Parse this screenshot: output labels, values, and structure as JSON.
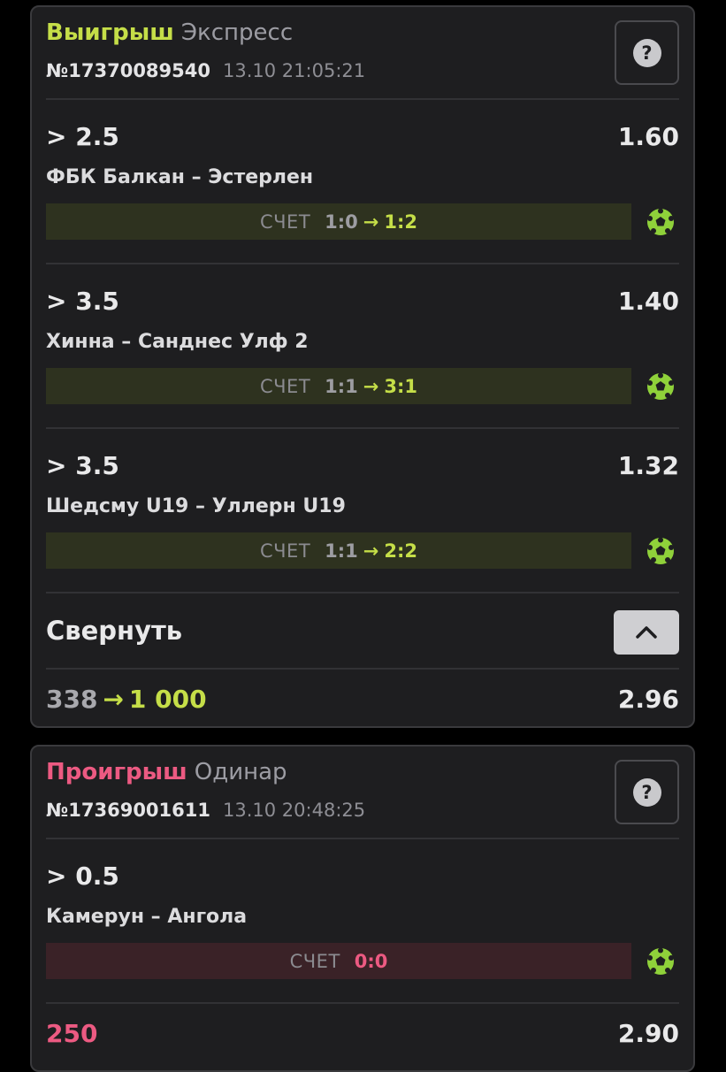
{
  "bets": [
    {
      "status": "Выигрыш",
      "type": "Экспресс",
      "ticket_number": "№17370089540",
      "datetime": "13.10 21:05:21",
      "help_icon": "?",
      "selections": [
        {
          "market": "> 2.5",
          "odds": "1.60",
          "match": "ФБК Балкан – Эстерлен",
          "score_label": "СЧЕТ",
          "score_from": "1:0",
          "score_arrow": "→",
          "score_to": "1:2"
        },
        {
          "market": "> 3.5",
          "odds": "1.40",
          "match": "Хинна – Санднес Улф 2",
          "score_label": "СЧЕТ",
          "score_from": "1:1",
          "score_arrow": "→",
          "score_to": "3:1"
        },
        {
          "market": "> 3.5",
          "odds": "1.32",
          "match": "Шедсму U19 – Уллерн U19",
          "score_label": "СЧЕТ",
          "score_from": "1:1",
          "score_arrow": "→",
          "score_to": "2:2"
        }
      ],
      "collapse_label": "Свернуть",
      "stake": "338",
      "stake_arrow": "→",
      "payout": "1 000",
      "total_odds": "2.96"
    },
    {
      "status": "Проигрыш",
      "type": "Одинар",
      "ticket_number": "№17369001611",
      "datetime": "13.10 20:48:25",
      "help_icon": "?",
      "selections": [
        {
          "market": "> 0.5",
          "odds": "",
          "match": "Камерун – Ангола",
          "score_label": "СЧЕТ",
          "score": "0:0"
        }
      ],
      "stake": "250",
      "total_odds": "2.90"
    }
  ],
  "colors": {
    "win": "#c5de48",
    "lose": "#ec5a82",
    "card_bg": "#1e1e20",
    "page_bg": "#000000",
    "ball_icon": "#8fd13a"
  },
  "icons": {
    "help": "question-circle-icon",
    "sport": "soccer-ball-icon",
    "collapse": "chevron-up-icon"
  }
}
